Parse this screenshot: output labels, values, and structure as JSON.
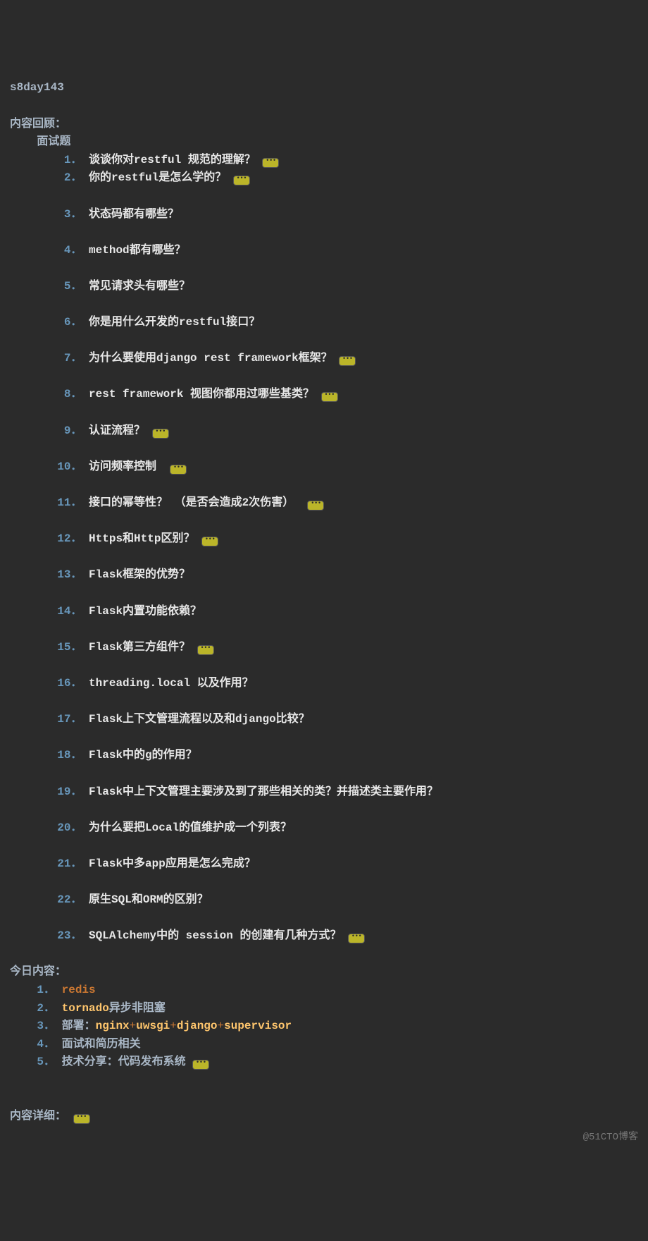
{
  "title": "s8day143",
  "section_review": "内容回顾：",
  "subsection_interview": "面试题",
  "questions": [
    {
      "n": "1．",
      "text": "谈谈你对restful 规范的理解？",
      "badge": true,
      "blank_after": false
    },
    {
      "n": "2．",
      "text": "你的restful是怎么学的？",
      "badge": true,
      "blank_after": true
    },
    {
      "n": "3．",
      "text": "状态码都有哪些？",
      "badge": false,
      "blank_after": true
    },
    {
      "n": "4．",
      "text": "method都有哪些？",
      "badge": false,
      "blank_after": true
    },
    {
      "n": "5．",
      "text": "常见请求头有哪些？",
      "badge": false,
      "blank_after": true
    },
    {
      "n": "6．",
      "text": "你是用什么开发的restful接口？",
      "badge": false,
      "blank_after": true
    },
    {
      "n": "7．",
      "text": "为什么要使用django rest framework框架？",
      "badge": true,
      "blank_after": true
    },
    {
      "n": "8．",
      "text": "rest framework 视图你都用过哪些基类？",
      "badge": true,
      "blank_after": true
    },
    {
      "n": "9．",
      "text": "认证流程？",
      "badge": true,
      "blank_after": true
    },
    {
      "n": "10．",
      "text": "访问频率控制 ",
      "badge": true,
      "blank_after": true
    },
    {
      "n": "11．",
      "text": "接口的幂等性？ （是否会造成2次伤害） ",
      "badge": true,
      "blank_after": true
    },
    {
      "n": "12．",
      "text": "Https和Http区别？",
      "badge": true,
      "blank_after": true
    },
    {
      "n": "13．",
      "text": "Flask框架的优势？",
      "badge": false,
      "blank_after": true
    },
    {
      "n": "14．",
      "text": "Flask内置功能依赖？",
      "badge": false,
      "blank_after": true
    },
    {
      "n": "15．",
      "text": "Flask第三方组件？",
      "badge": true,
      "blank_after": true
    },
    {
      "n": "16．",
      "text": "threading.local 以及作用？",
      "badge": false,
      "blank_after": true
    },
    {
      "n": "17．",
      "text": "Flask上下文管理流程以及和django比较？",
      "badge": false,
      "blank_after": true
    },
    {
      "n": "18．",
      "text": "Flask中的g的作用？",
      "badge": false,
      "blank_after": true
    },
    {
      "n": "19．",
      "text": "Flask中上下文管理主要涉及到了那些相关的类？并描述类主要作用？",
      "badge": false,
      "blank_after": true
    },
    {
      "n": "20．",
      "text": "为什么要把Local的值维护成一个列表？",
      "badge": false,
      "blank_after": true
    },
    {
      "n": "21．",
      "text": "Flask中多app应用是怎么完成？",
      "badge": false,
      "blank_after": true
    },
    {
      "n": "22．",
      "text": "原生SQL和ORM的区别？",
      "badge": false,
      "blank_after": true
    },
    {
      "n": "23．",
      "text": "SQLAlchemy中的 session 的创建有几种方式？",
      "badge": true,
      "blank_after": true
    }
  ],
  "section_today": "今日内容：",
  "today_items": [
    {
      "n": "1．",
      "parts": [
        {
          "t": "redis",
          "c": "kw-purple"
        }
      ]
    },
    {
      "n": "2．",
      "parts": [
        {
          "t": "tornado",
          "c": "kw-yellow"
        },
        {
          "t": "异步非阻塞",
          "c": "plain"
        }
      ]
    },
    {
      "n": "3．",
      "parts": [
        {
          "t": "部署：",
          "c": "plain"
        },
        {
          "t": "nginx",
          "c": "kw-yellow"
        },
        {
          "t": "+",
          "c": "op"
        },
        {
          "t": "uwsgi",
          "c": "kw-yellow"
        },
        {
          "t": "+",
          "c": "op"
        },
        {
          "t": "django",
          "c": "kw-yellow"
        },
        {
          "t": "+",
          "c": "op"
        },
        {
          "t": "supervisor",
          "c": "kw-yellow"
        }
      ]
    },
    {
      "n": "4．",
      "parts": [
        {
          "t": "面试和简历相关",
          "c": "plain"
        }
      ]
    },
    {
      "n": "5．",
      "parts": [
        {
          "t": "技术分享：",
          "c": "plain"
        },
        {
          "t": "代码发布系统",
          "c": "plain"
        }
      ],
      "badge": true
    }
  ],
  "section_detail": "内容详细：",
  "detail_badge": true,
  "watermark": "@51CTO博客"
}
